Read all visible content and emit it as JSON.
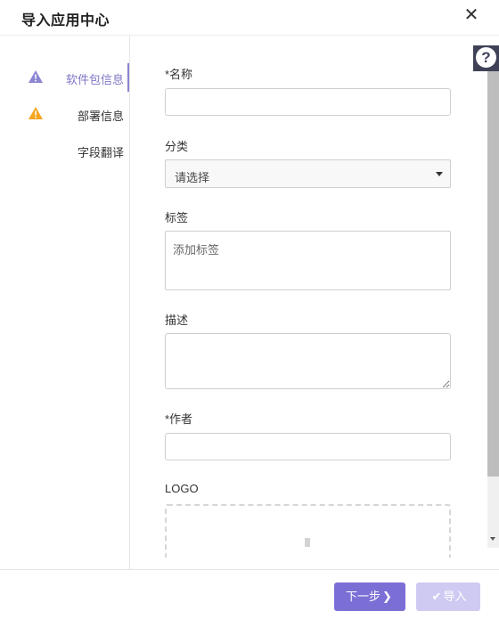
{
  "dialog": {
    "title": "导入应用中心",
    "close_icon": "✕"
  },
  "steps": [
    {
      "label": "软件包信息",
      "icon": "warning-icon",
      "icon_color": "#8b84d2",
      "active": true
    },
    {
      "label": "部署信息",
      "icon": "warning-icon",
      "icon_color": "#f5a623",
      "active": false
    },
    {
      "label": "字段翻译",
      "icon": "",
      "active": false
    }
  ],
  "form": {
    "name_label": "*名称",
    "name_value": "",
    "category_label": "分类",
    "category_value": "请选择",
    "tags_label": "标签",
    "tags_placeholder": "添加标签",
    "description_label": "描述",
    "description_value": "",
    "author_label": "*作者",
    "author_value": "",
    "logo_label": "LOGO"
  },
  "help": {
    "icon": "question-icon",
    "glyph": "?"
  },
  "footer": {
    "next_label": "下一步",
    "next_icon": "❯",
    "import_label": "导入",
    "import_icon": "✔"
  },
  "colors": {
    "accent": "#7b6fd6",
    "accent_disabled": "#cfcaf1",
    "warning": "#f5a623"
  }
}
